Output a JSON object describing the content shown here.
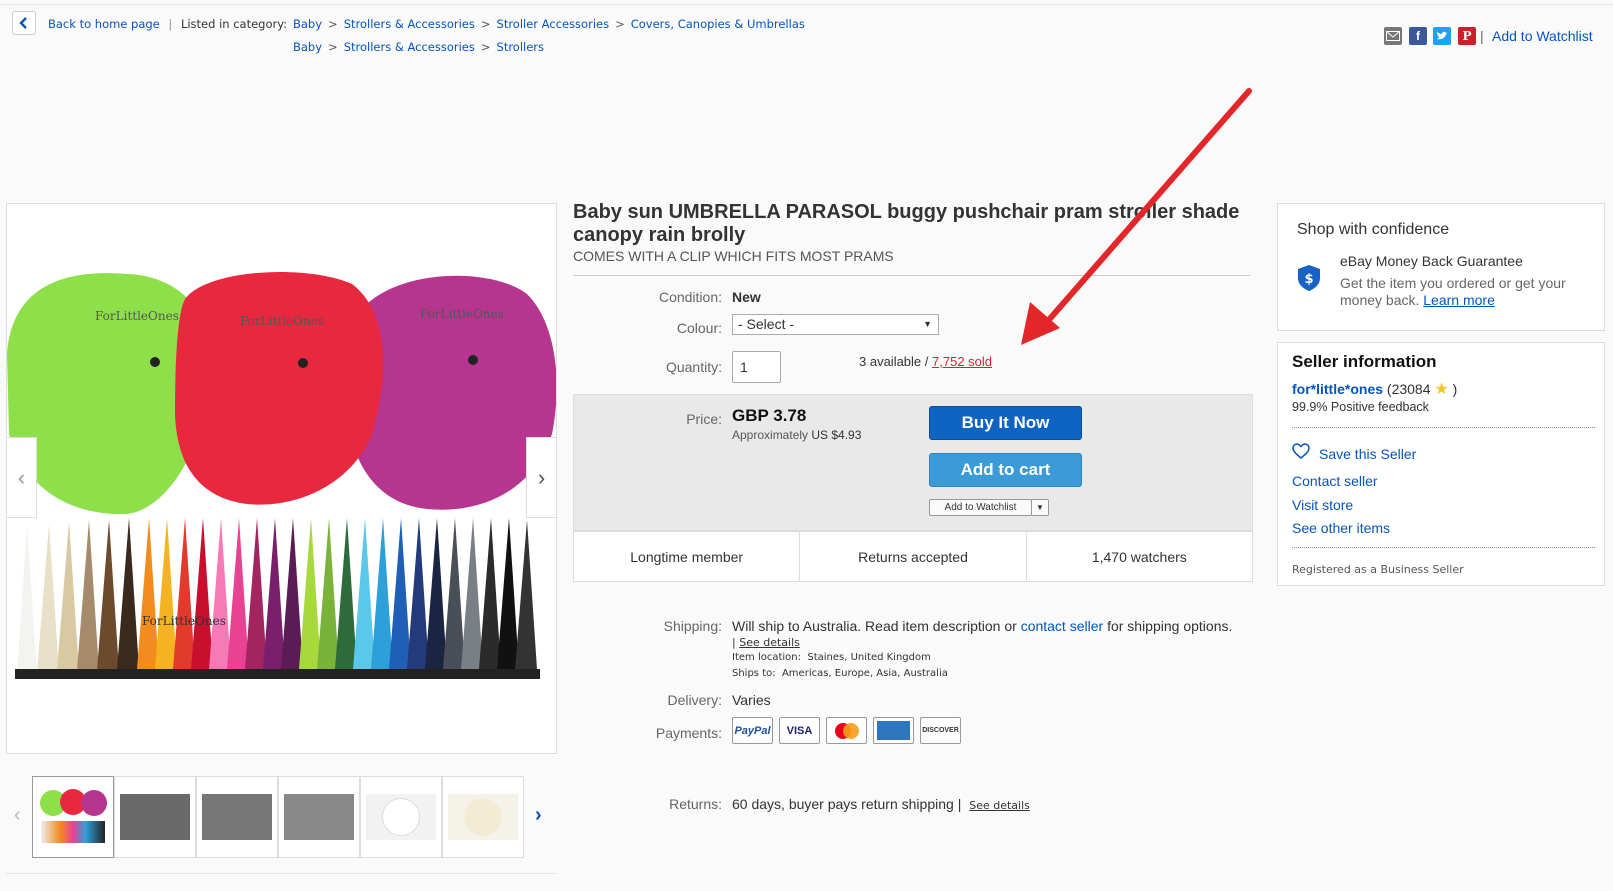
{
  "breadcrumb": {
    "back_label": "Back to home page",
    "listed_label": "Listed in category:",
    "row1": [
      "Baby",
      "Strollers & Accessories",
      "Stroller Accessories",
      "Covers, Canopies & Umbrellas"
    ],
    "row2": [
      "Baby",
      "Strollers & Accessories",
      "Strollers"
    ],
    "separator": ">"
  },
  "share": {
    "email_icon": "email-icon",
    "facebook_icon": "facebook-icon",
    "twitter_icon": "twitter-icon",
    "pinterest_icon": "pinterest-icon",
    "separator": "|",
    "watchlist_label": "Add to Watchlist"
  },
  "gallery": {
    "watermark": "ForLittleOnes",
    "umbrella_colors": [
      "#8ee04a",
      "#e8283f",
      "#b6368f"
    ],
    "prev_icon": "chevron-left-icon",
    "next_icon": "chevron-right-icon",
    "thumb_next_icon": "chevron-right-icon"
  },
  "item": {
    "title": "Baby sun UMBRELLA PARASOL buggy pushchair pram stroller shade canopy rain brolly",
    "subtitle": "COMES WITH A CLIP WHICH FITS MOST PRAMS",
    "condition_label": "Condition:",
    "condition_value": "New",
    "colour_label": "Colour:",
    "colour_value": "- Select -",
    "quantity_label": "Quantity:",
    "quantity_value": "1",
    "available_text": "3 available /",
    "sold_text": "7,752 sold"
  },
  "price": {
    "label": "Price:",
    "value": "GBP 3.78",
    "approx_label": "Approximately",
    "approx_value": "US $4.93",
    "buy_now": "Buy It Now",
    "add_to_cart": "Add to cart",
    "add_to_watchlist": "Add to Watchlist"
  },
  "stats": [
    "Longtime member",
    "Returns accepted",
    "1,470 watchers"
  ],
  "shipping": {
    "label": "Shipping:",
    "text_before": "Will ship to Australia. Read item description or",
    "contact_link": "contact seller",
    "text_after": "for shipping options.",
    "see_details_prefix": "|",
    "see_details": "See details",
    "location_label": "Item location:",
    "location_value": "Staines, United Kingdom",
    "ships_to_label": "Ships to:",
    "ships_to_value": "Americas, Europe, Asia, Australia"
  },
  "delivery": {
    "label": "Delivery:",
    "value": "Varies"
  },
  "payments": {
    "label": "Payments:",
    "methods": [
      "PayPal",
      "VISA",
      "mastercard-icon",
      "amex-icon",
      "DISCOVER"
    ]
  },
  "returns": {
    "label": "Returns:",
    "value": "60 days, buyer pays return shipping |",
    "see_details": "See details"
  },
  "confidence": {
    "heading": "Shop with confidence",
    "mbg_title": "eBay Money Back Guarantee",
    "mbg_desc": "Get the item you ordered or get your money back.",
    "learn_more": "Learn more"
  },
  "seller": {
    "heading": "Seller information",
    "name": "for*little*ones",
    "score_open": "(23084",
    "score_close": ")",
    "feedback": "99.9% Positive feedback",
    "save": "Save this Seller",
    "contact": "Contact seller",
    "store": "Visit store",
    "other": "See other items",
    "registered": "Registered as a Business Seller"
  },
  "colors": {
    "link": "#0654ba",
    "buy_button": "#0f63c1",
    "cart_button": "#3b9ad8",
    "sold_red": "#dd1e31",
    "annotation_arrow": "#e3262a"
  }
}
